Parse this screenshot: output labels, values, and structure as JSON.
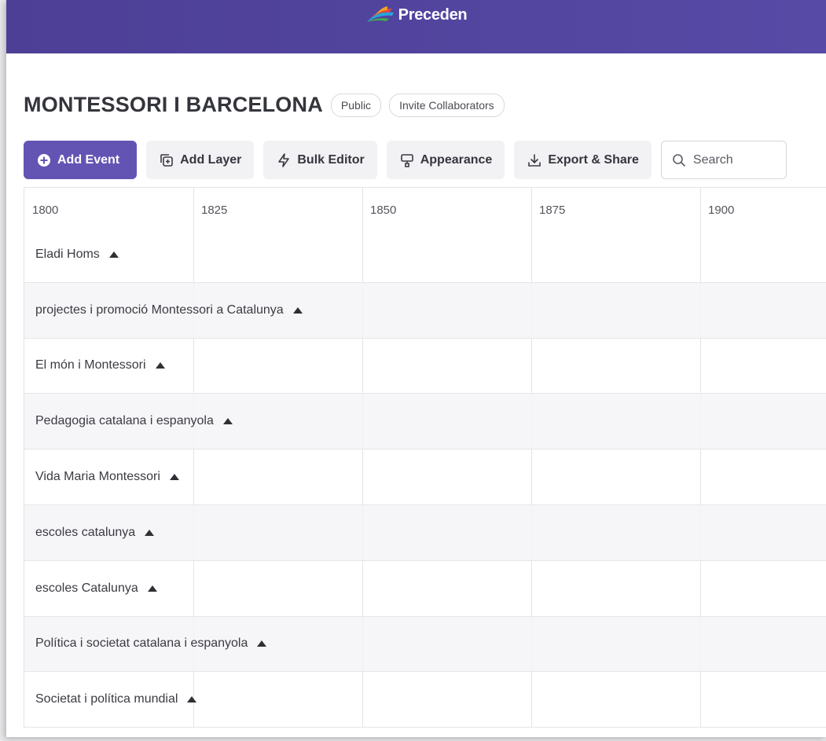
{
  "app": {
    "brand_name": "Preceden",
    "brand_colors": [
      "#3fb04b",
      "#f1a21c",
      "#e3463c",
      "#27a3dc"
    ]
  },
  "header": {
    "title": "MONTESSORI I BARCELONA",
    "visibility_label": "Public",
    "invite_label": "Invite Collaborators"
  },
  "toolbar": {
    "add_event": {
      "label": "Add Event",
      "icon": "plus-circle-icon"
    },
    "add_layer": {
      "label": "Add Layer",
      "icon": "layers-plus-icon"
    },
    "bulk_editor": {
      "label": "Bulk Editor",
      "icon": "lightning-icon"
    },
    "appearance": {
      "label": "Appearance",
      "icon": "paint-roller-icon"
    },
    "export_share": {
      "label": "Export & Share",
      "icon": "download-icon"
    },
    "search": {
      "placeholder": "Search",
      "icon": "search-icon"
    }
  },
  "timeline": {
    "years": [
      "1800",
      "1825",
      "1850",
      "1875",
      "1900"
    ],
    "layers": [
      {
        "label": "Eladi Homs",
        "collapse_icon": "triangle-up-icon"
      },
      {
        "label": "projectes i promoció Montessori a Catalunya",
        "collapse_icon": "triangle-up-icon"
      },
      {
        "label": "El món i Montessori",
        "collapse_icon": "triangle-up-icon"
      },
      {
        "label": "Pedagogia catalana i espanyola",
        "collapse_icon": "triangle-up-icon"
      },
      {
        "label": "Vida Maria Montessori",
        "collapse_icon": "triangle-up-icon"
      },
      {
        "label": "escoles catalunya",
        "collapse_icon": "triangle-up-icon"
      },
      {
        "label": "escoles Catalunya",
        "collapse_icon": "triangle-up-icon"
      },
      {
        "label": "Política i societat catalana i espanyola",
        "collapse_icon": "triangle-up-icon"
      },
      {
        "label": "Societat i política mundial",
        "collapse_icon": "triangle-up-icon"
      }
    ]
  },
  "colors": {
    "topbar": "#4f429c",
    "primary_button": "#6354b4"
  }
}
